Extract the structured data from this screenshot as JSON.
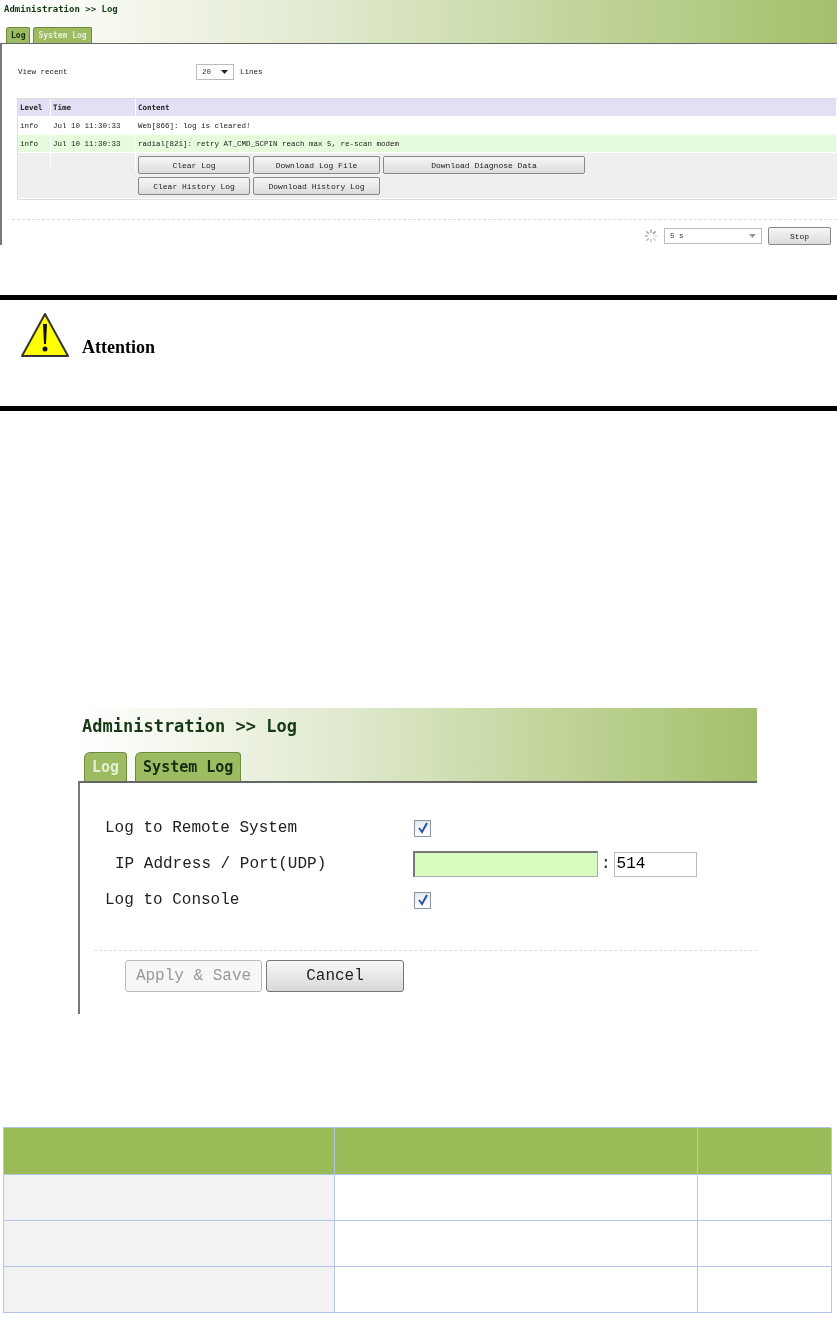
{
  "log_screen": {
    "breadcrumb": "Administration >> Log",
    "tabs": [
      {
        "label": "Log",
        "selected": true
      },
      {
        "label": "System Log",
        "selected": false
      }
    ],
    "view_recent": {
      "label": "View recent",
      "value": "20",
      "unit": "Lines"
    },
    "table": {
      "columns": [
        "Level",
        "Time",
        "Content"
      ],
      "rows": [
        {
          "level": "info",
          "time": "Jul 10 11:30:33",
          "content": "Web[866]: log is cleared!",
          "highlighted": false
        },
        {
          "level": "info",
          "time": "Jul 10 11:30:33",
          "content": "radial[821]: retry AT_CMD_SCPIN reach max 5, re-scan modem",
          "highlighted": true
        }
      ]
    },
    "button_rows": [
      [
        "Clear Log",
        "Download Log File",
        "Download Diagnose Data"
      ],
      [
        "Clear History Log",
        "Download History Log"
      ]
    ],
    "refresh": {
      "interval": "5 s",
      "button": "Stop"
    }
  },
  "attention": {
    "title": "Attention"
  },
  "syslog_screen": {
    "breadcrumb": "Administration >> Log",
    "tabs": [
      {
        "label": "Log",
        "selected": false
      },
      {
        "label": "System Log",
        "selected": true
      }
    ],
    "fields": [
      {
        "kind": "checkbox",
        "label": "Log to Remote System",
        "checked": true
      },
      {
        "kind": "address",
        "label": "IP Address / Port(UDP)",
        "separator": ":",
        "port": "514"
      },
      {
        "kind": "checkbox",
        "label": "Log to Console",
        "checked": true
      }
    ],
    "buttons": [
      {
        "label": "Apply & Save",
        "disabled": true
      },
      {
        "label": "Cancel",
        "disabled": false
      }
    ]
  }
}
